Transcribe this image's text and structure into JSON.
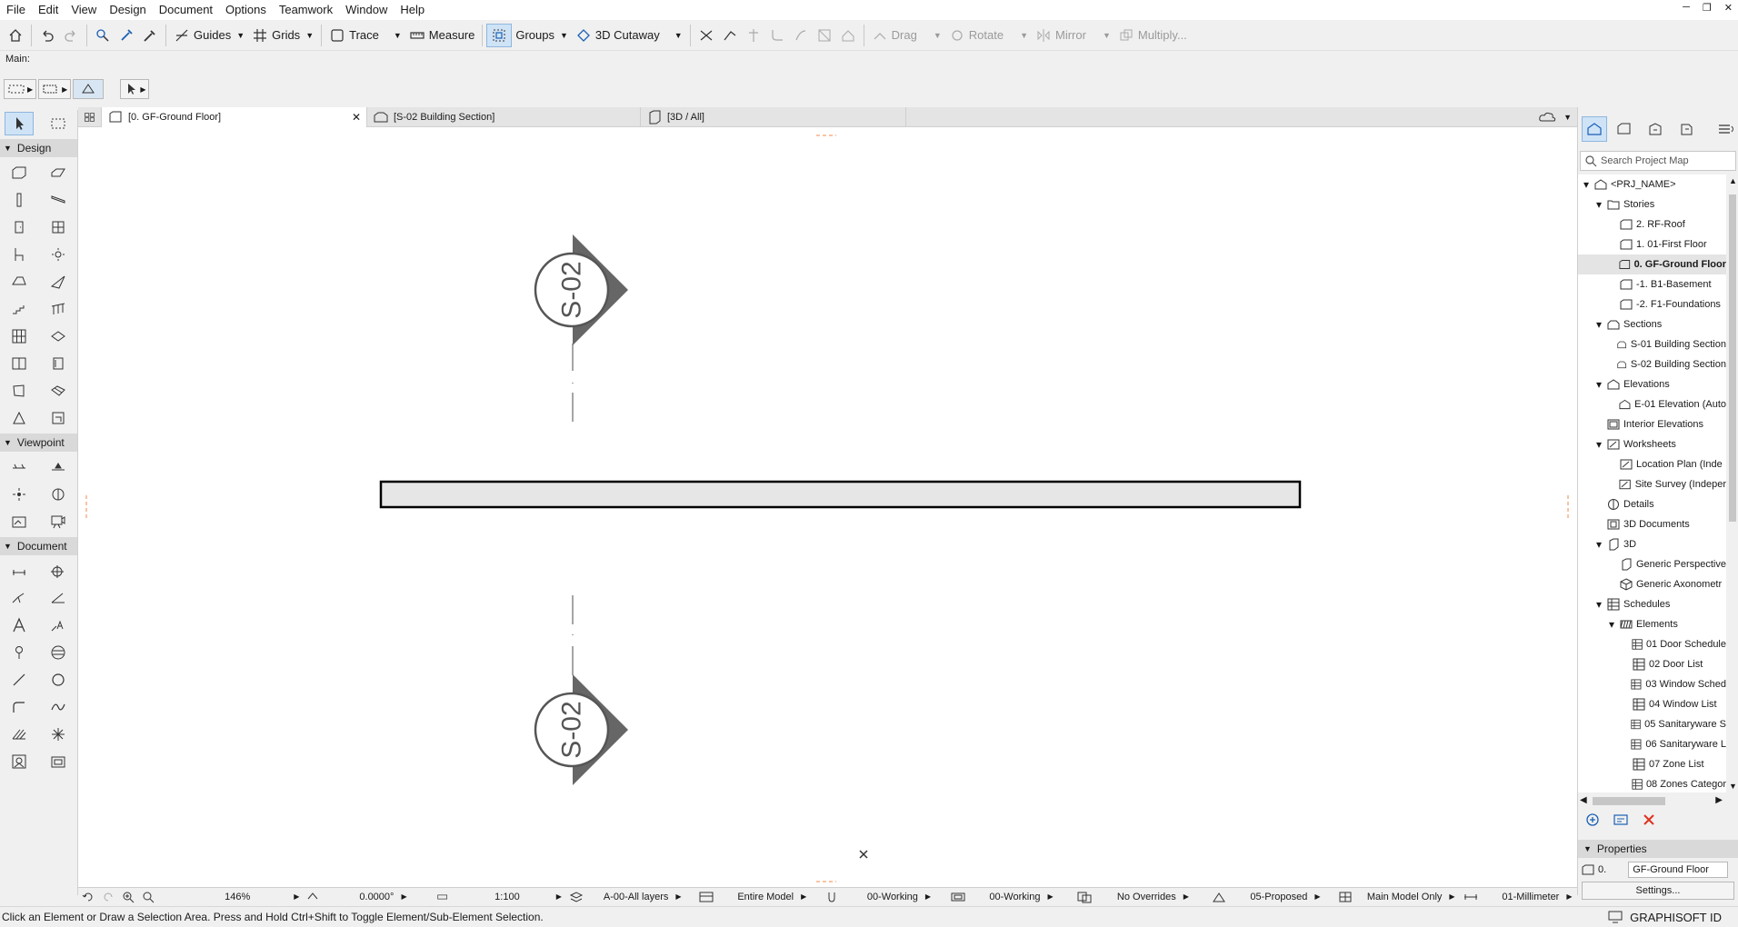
{
  "menu": [
    "File",
    "Edit",
    "View",
    "Design",
    "Document",
    "Options",
    "Teamwork",
    "Window",
    "Help"
  ],
  "toolbar": {
    "guides": "Guides",
    "grids": "Grids",
    "trace": "Trace",
    "measure": "Measure",
    "groups": "Groups",
    "cutaway": "3D Cutaway",
    "drag": "Drag",
    "rotate": "Rotate",
    "mirror": "Mirror",
    "multiply": "Multiply..."
  },
  "main_label": "Main:",
  "toolbox": {
    "design": "Design",
    "viewpoint": "Viewpoint",
    "document": "Document"
  },
  "tabs": [
    {
      "label": "[0. GF-Ground Floor]"
    },
    {
      "label": "[S-02 Building Section]"
    },
    {
      "label": "[3D / All]"
    }
  ],
  "canvas": {
    "section_marker_label": "S-02"
  },
  "navigator": {
    "search_placeholder": "Search Project Map",
    "tree": [
      {
        "label": "<PRJ_NAME>",
        "level": 0,
        "caret": "open",
        "icon": "project"
      },
      {
        "label": "Stories",
        "level": 1,
        "caret": "open",
        "icon": "folder"
      },
      {
        "label": "2. RF-Roof",
        "level": 2,
        "caret": "",
        "icon": "story"
      },
      {
        "label": "1. 01-First Floor",
        "level": 2,
        "caret": "",
        "icon": "story"
      },
      {
        "label": "0. GF-Ground Floor",
        "level": 2,
        "caret": "",
        "icon": "story",
        "selected": true
      },
      {
        "label": "-1. B1-Basement",
        "level": 2,
        "caret": "",
        "icon": "story"
      },
      {
        "label": "-2. F1-Foundations",
        "level": 2,
        "caret": "",
        "icon": "story"
      },
      {
        "label": "Sections",
        "level": 1,
        "caret": "open",
        "icon": "section"
      },
      {
        "label": "S-01 Building Section",
        "level": 2,
        "caret": "",
        "icon": "section"
      },
      {
        "label": "S-02 Building Section",
        "level": 2,
        "caret": "",
        "icon": "section"
      },
      {
        "label": "Elevations",
        "level": 1,
        "caret": "open",
        "icon": "elevation"
      },
      {
        "label": "E-01 Elevation (Auto",
        "level": 2,
        "caret": "",
        "icon": "elevation"
      },
      {
        "label": "Interior Elevations",
        "level": 1,
        "caret": "",
        "icon": "interior"
      },
      {
        "label": "Worksheets",
        "level": 1,
        "caret": "open",
        "icon": "worksheet"
      },
      {
        "label": "Location Plan (Inde",
        "level": 2,
        "caret": "",
        "icon": "worksheet"
      },
      {
        "label": "Site Survey (Indeper",
        "level": 2,
        "caret": "",
        "icon": "worksheet"
      },
      {
        "label": "Details",
        "level": 1,
        "caret": "",
        "icon": "details"
      },
      {
        "label": "3D Documents",
        "level": 1,
        "caret": "",
        "icon": "3ddoc"
      },
      {
        "label": "3D",
        "level": 1,
        "caret": "open",
        "icon": "3d"
      },
      {
        "label": "Generic Perspective",
        "level": 2,
        "caret": "",
        "icon": "3d"
      },
      {
        "label": "Generic Axonometr",
        "level": 2,
        "caret": "",
        "icon": "axo"
      },
      {
        "label": "Schedules",
        "level": 1,
        "caret": "open",
        "icon": "schedule"
      },
      {
        "label": "Elements",
        "level": 2,
        "caret": "open",
        "icon": "elements"
      },
      {
        "label": "01 Door Schedule",
        "level": 3,
        "caret": "",
        "icon": "schedule"
      },
      {
        "label": "02 Door List",
        "level": 3,
        "caret": "",
        "icon": "schedule"
      },
      {
        "label": "03 Window Sched",
        "level": 3,
        "caret": "",
        "icon": "schedule"
      },
      {
        "label": "04 Window List",
        "level": 3,
        "caret": "",
        "icon": "schedule"
      },
      {
        "label": "05 Sanitaryware S",
        "level": 3,
        "caret": "",
        "icon": "schedule"
      },
      {
        "label": "06 Sanitaryware L",
        "level": 3,
        "caret": "",
        "icon": "schedule"
      },
      {
        "label": "07 Zone List",
        "level": 3,
        "caret": "",
        "icon": "schedule"
      },
      {
        "label": "08 Zones Categor",
        "level": 3,
        "caret": "",
        "icon": "schedule"
      }
    ],
    "properties_label": "Properties",
    "properties_story_number": "0.",
    "properties_story_name": "GF-Ground Floor",
    "settings_button": "Settings..."
  },
  "bottombar": {
    "zoom": "146%",
    "angle": "0.0000°",
    "scale": "1:100",
    "layers": "A-00-All layers",
    "model": "Entire Model",
    "pen_set": "00-Working",
    "model_view": "00-Working",
    "overrides": "No Overrides",
    "renovation": "05-Proposed",
    "structure": "Main Model Only",
    "dimension": "01-Millimeter"
  },
  "status_text": "Click an Element or Draw a Selection Area. Press and Hold Ctrl+Shift to Toggle Element/Sub-Element Selection.",
  "brand": "GRAPHISOFT ID"
}
